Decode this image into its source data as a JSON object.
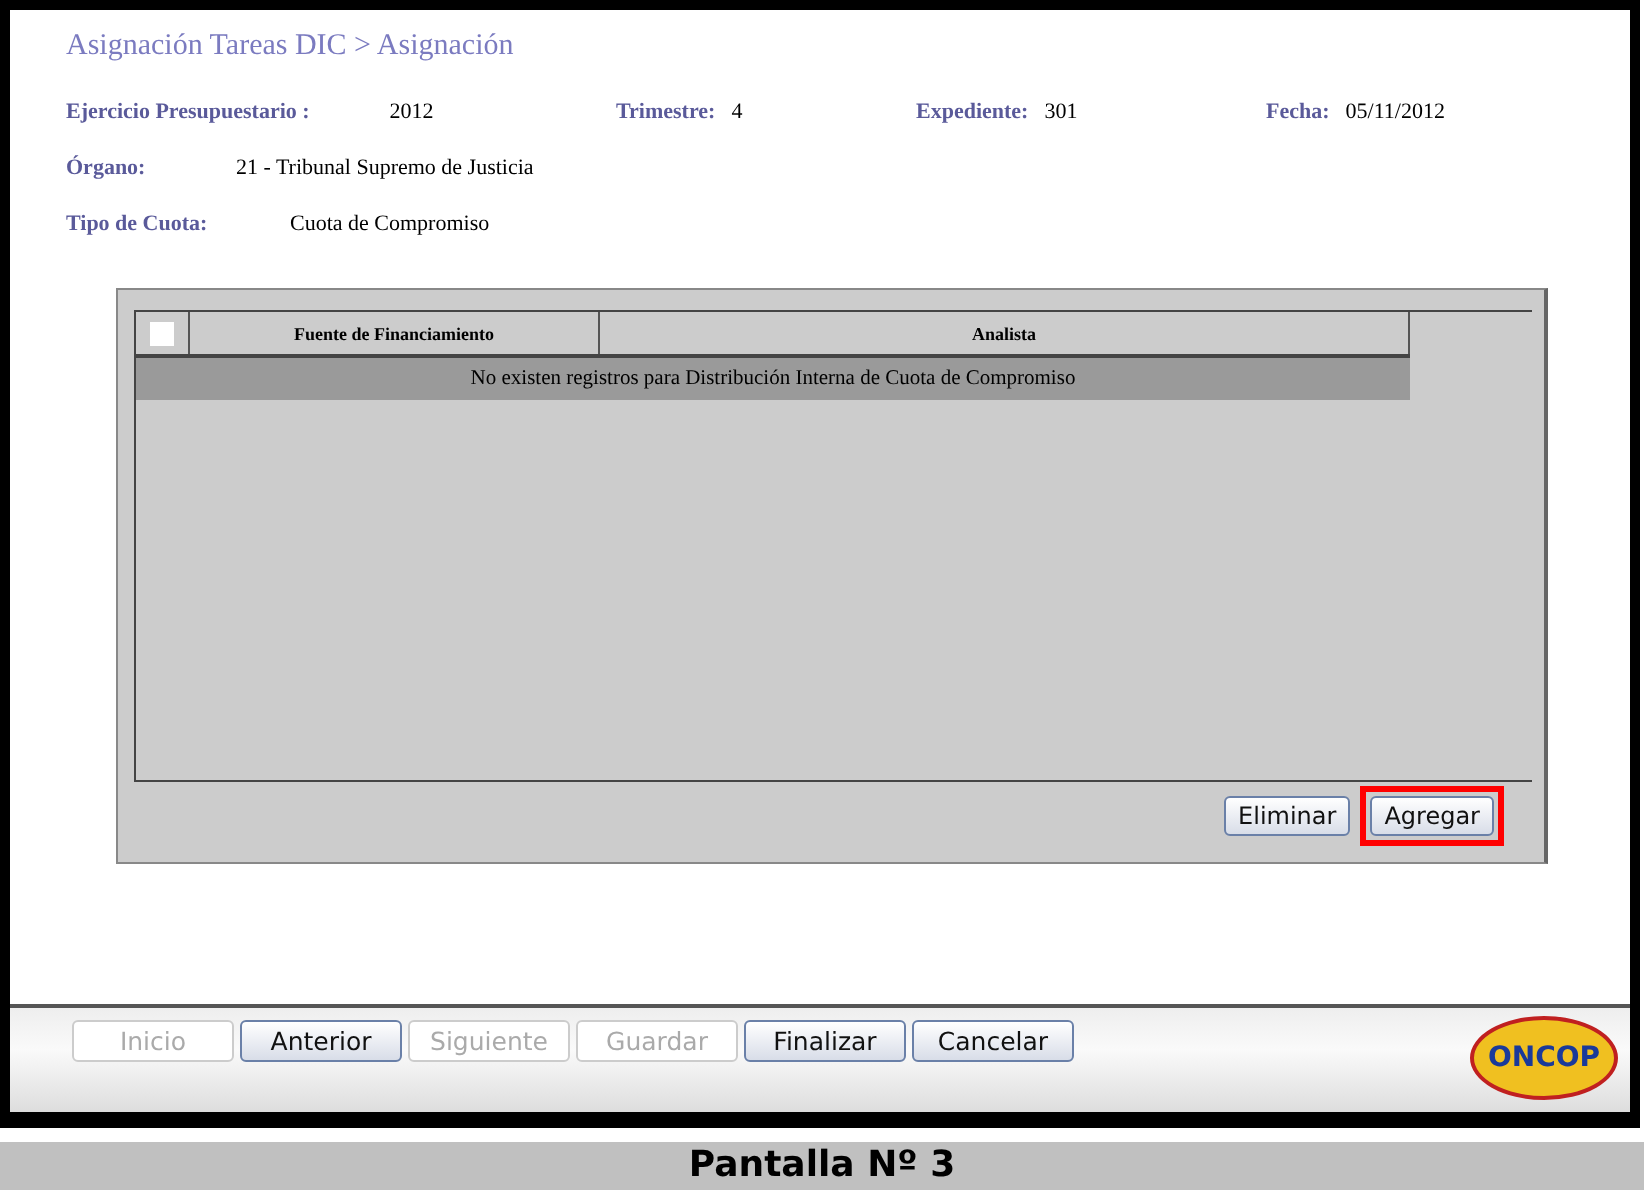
{
  "title": "Asignación Tareas DIC > Asignación",
  "fields_row": [
    {
      "label": "Ejercicio Presupuestario :",
      "value": "2012"
    },
    {
      "label": "Trimestre:",
      "value": "4"
    },
    {
      "label": "Expediente:",
      "value": "301"
    },
    {
      "label": "Fecha:",
      "value": "05/11/2012"
    }
  ],
  "fields": [
    {
      "label": "Órgano:",
      "value": "21 - Tribunal Supremo de Justicia"
    },
    {
      "label": "Tipo de Cuota:",
      "value": "Cuota de Compromiso"
    }
  ],
  "table": {
    "select_all_checked": false,
    "columns": [
      "Fuente de Financiamiento",
      "Analista"
    ],
    "empty_message": "No existen registros para Distribución Interna de Cuota de Compromiso"
  },
  "panel_buttons": [
    {
      "label": "Eliminar",
      "highlighted": false
    },
    {
      "label": "Agregar",
      "highlighted": true
    }
  ],
  "footer_buttons": [
    {
      "label": "Inicio",
      "disabled": true
    },
    {
      "label": "Anterior",
      "disabled": false
    },
    {
      "label": "Siguiente",
      "disabled": true
    },
    {
      "label": "Guardar",
      "disabled": true
    },
    {
      "label": "Finalizar",
      "disabled": false
    },
    {
      "label": "Cancelar",
      "disabled": false
    }
  ],
  "logo": {
    "text": "ONCOP"
  },
  "caption": "Pantalla Nº 3"
}
